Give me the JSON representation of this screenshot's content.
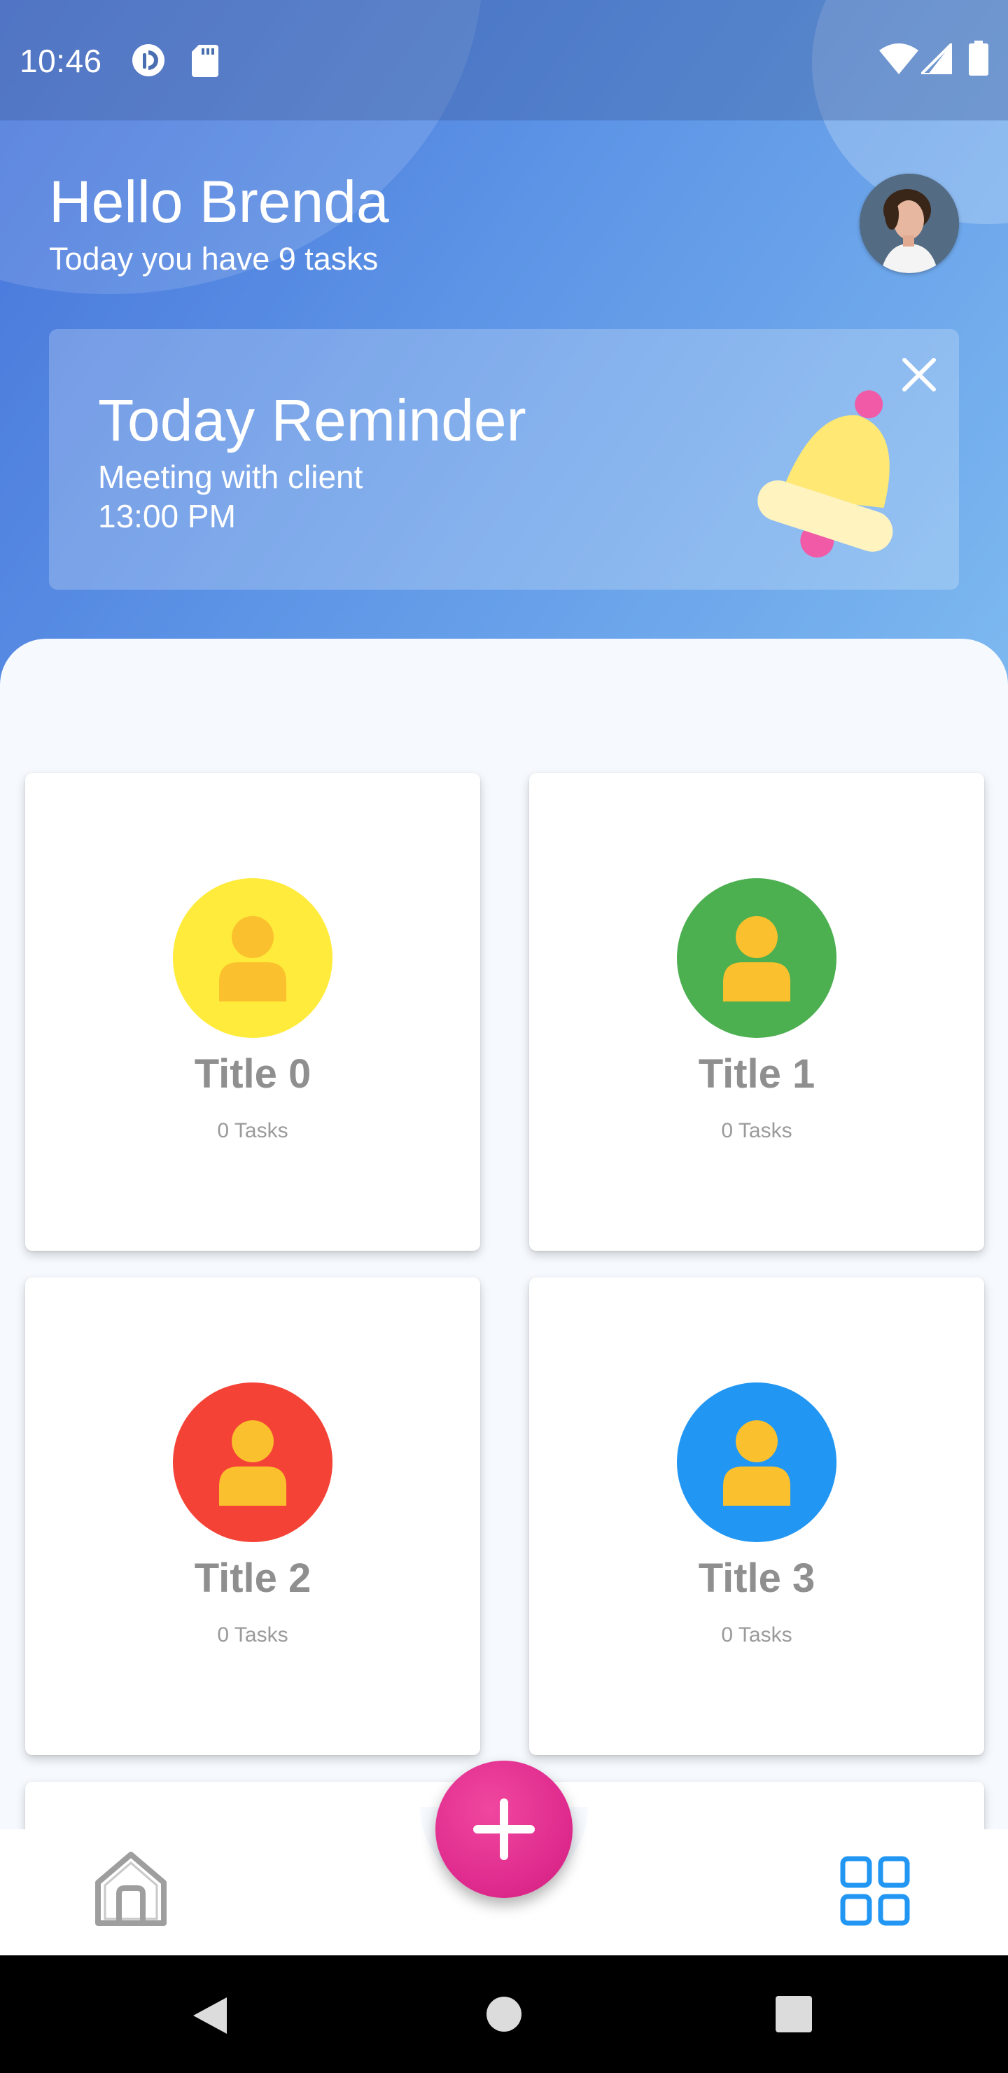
{
  "status_bar": {
    "time": "10:46"
  },
  "header": {
    "greeting": "Hello Brenda",
    "subtitle": "Today you have 9 tasks"
  },
  "reminder": {
    "title": "Today Reminder",
    "text": "Meeting with client",
    "time": "13:00 PM"
  },
  "cards": [
    {
      "title": "Title 0",
      "tasks": "0 Tasks",
      "color": "#ffeb3b"
    },
    {
      "title": "Title 1",
      "tasks": "0 Tasks",
      "color": "#4caf50"
    },
    {
      "title": "Title 2",
      "tasks": "0 Tasks",
      "color": "#f44336"
    },
    {
      "title": "Title 3",
      "tasks": "0 Tasks",
      "color": "#2196f3"
    }
  ],
  "colors": {
    "accent": "#e02d8f",
    "nav_active": "#2196f3",
    "nav_inactive": "#9e9e9e",
    "person_icon": "#fbc02d"
  },
  "icons": {
    "status": [
      "pocket-casts-icon",
      "sd-card-icon",
      "wifi-icon",
      "cellular-signal-icon",
      "battery-icon"
    ],
    "reminder": [
      "close-icon",
      "bell-icon"
    ],
    "cards": "person-icon",
    "fab": "plus-icon",
    "bottom_nav": [
      "home-icon",
      "grid-icon"
    ],
    "system_nav": [
      "back-icon",
      "home-circle-icon",
      "recents-icon"
    ]
  }
}
